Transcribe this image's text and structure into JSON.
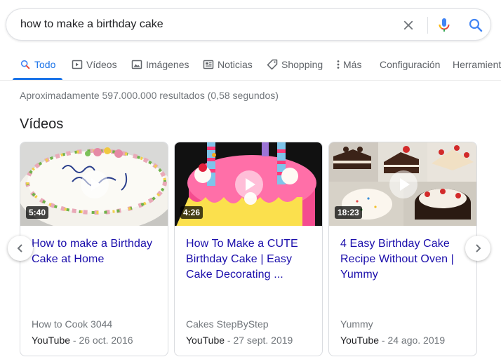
{
  "search": {
    "query": "how to make a birthday cake",
    "clear_icon": "close-icon",
    "mic_icon": "microphone-icon",
    "search_icon": "search-icon"
  },
  "tabs": [
    {
      "label": "Todo",
      "icon": "search-icon",
      "active": true
    },
    {
      "label": "Vídeos",
      "icon": "video-icon"
    },
    {
      "label": "Imágenes",
      "icon": "image-icon"
    },
    {
      "label": "Noticias",
      "icon": "news-icon"
    },
    {
      "label": "Shopping",
      "icon": "tag-icon"
    },
    {
      "label": "Más",
      "icon": "more-vert-icon"
    },
    {
      "label": "Configuración"
    },
    {
      "label": "Herramientas"
    }
  ],
  "result_stats": "Aproximadamente 597.000.000 resultados (0,58 segundos)",
  "videos": {
    "title": "Vídeos",
    "items": [
      {
        "duration": "5:40",
        "title": "How to make a Birthday Cake at Home",
        "channel": "How to Cook 3044",
        "source": "YouTube",
        "date": "- 26 oct. 2016"
      },
      {
        "duration": "4:26",
        "title": "How To Make a CUTE Birthday Cake | Easy Cake Decorating ...",
        "channel": "Cakes StepByStep",
        "source": "YouTube",
        "date": "- 27 sept. 2019"
      },
      {
        "duration": "18:23",
        "title": "4 Easy Birthday Cake Recipe Without Oven | Yummy",
        "channel": "Yummy",
        "source": "YouTube",
        "date": "- 24 ago. 2019"
      }
    ]
  },
  "colors": {
    "link": "#1a0dab",
    "accent": "#1a73e8",
    "muted": "#70757a"
  }
}
